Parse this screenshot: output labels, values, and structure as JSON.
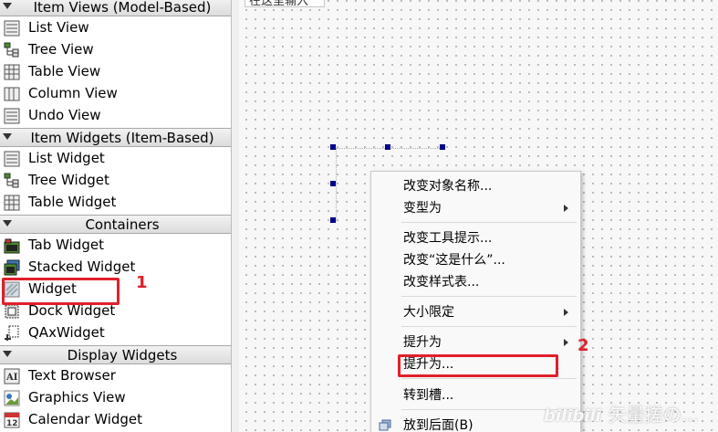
{
  "widget_box": {
    "categories": [
      {
        "label": "Item Views (Model-Based)"
      },
      {
        "label": "Item Widgets (Item-Based)"
      },
      {
        "label": "Containers"
      },
      {
        "label": "Display Widgets"
      }
    ],
    "item_views": [
      "List View",
      "Tree View",
      "Table View",
      "Column View",
      "Undo View"
    ],
    "item_widgets": [
      "List Widget",
      "Tree Widget",
      "Table Widget"
    ],
    "containers": [
      "Tab Widget",
      "Stacked Widget",
      "Widget",
      "Dock Widget",
      "QAxWidget"
    ],
    "display_widgets": [
      "Text Browser",
      "Graphics View",
      "Calendar Widget"
    ]
  },
  "canvas": {
    "menubar_placeholder": "在这里输入"
  },
  "context_menu": {
    "items": [
      {
        "label": "改变对象名称..."
      },
      {
        "label": "变型为"
      },
      {
        "label": "改变工具提示..."
      },
      {
        "label": "改变“这是什么”..."
      },
      {
        "label": "改变样式表..."
      },
      {
        "label": "大小限定"
      },
      {
        "label": "提升为"
      },
      {
        "label": "提升为..."
      },
      {
        "label": "转到槽..."
      },
      {
        "label": "放到后面(B)"
      }
    ]
  },
  "annotations": {
    "step1": "1",
    "step2": "2"
  },
  "watermark": {
    "logo": "bilibili",
    "text": "矢量搓の..."
  },
  "colors": {
    "highlight_red": "#e0202a",
    "handle_blue": "#00008b"
  }
}
